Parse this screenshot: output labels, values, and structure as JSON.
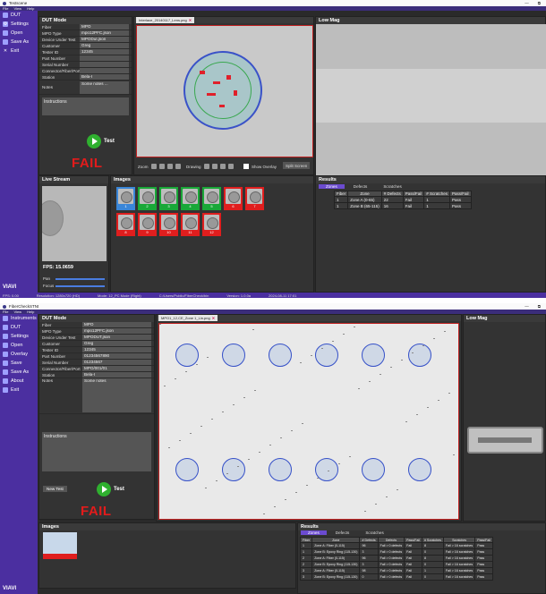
{
  "w1": {
    "title": "Testscene",
    "menu": [
      "File",
      "View",
      "Help"
    ],
    "win_controls": [
      "—",
      "⧉"
    ],
    "sidebar": [
      {
        "label": "DUT",
        "icon": "dut-icon"
      },
      {
        "label": "Settings",
        "icon": "gear-icon"
      },
      {
        "label": "Open",
        "icon": "folder-icon"
      },
      {
        "label": "Save As",
        "icon": "save-icon"
      },
      {
        "label": "Exit",
        "icon": "close-icon"
      }
    ],
    "brand": "VIAVI",
    "dut": {
      "header": "DUT Mode",
      "fields": [
        {
          "label": "Fiber",
          "value": "MPO"
        },
        {
          "label": "MPO Type",
          "value": "mpo12PFC.json"
        },
        {
          "label": "Device Under Test",
          "value": "MPODut.json"
        },
        {
          "label": "Customer",
          "value": "Greg"
        },
        {
          "label": "Tester ID",
          "value": "12345"
        },
        {
          "label": "Part Number",
          "value": ""
        },
        {
          "label": "Serial Number",
          "value": ""
        },
        {
          "label": "Connector/Fiber/Port",
          "value": ""
        },
        {
          "label": "Station",
          "value": "Bela-I"
        },
        {
          "label": "Notes",
          "value": "Some notes ..."
        }
      ],
      "instructions": "Instructions",
      "test_label": "Test",
      "result": "FAIL"
    },
    "scope_tab": "Interlace_20140117_Lens.png",
    "lowmag": "Low Mag",
    "toolbar": {
      "zoom": "Zoom",
      "drawing": "Drawing",
      "show_overlay": "Show Overlay",
      "split": "Split Screen"
    },
    "livestream": {
      "header": "Live Stream",
      "fps": "FPS: 15.0659",
      "pan": "Pan",
      "focus": "Focus"
    },
    "images": {
      "header": "Images",
      "thumbs": [
        {
          "n": "1",
          "c": "blue"
        },
        {
          "n": "2",
          "c": "green"
        },
        {
          "n": "3",
          "c": "green"
        },
        {
          "n": "4",
          "c": "green"
        },
        {
          "n": "5",
          "c": "green"
        },
        {
          "n": "6",
          "c": "red"
        },
        {
          "n": "7",
          "c": "red"
        },
        {
          "n": "8",
          "c": "red"
        },
        {
          "n": "9",
          "c": "red"
        },
        {
          "n": "10",
          "c": "red"
        },
        {
          "n": "11",
          "c": "red"
        },
        {
          "n": "12",
          "c": "red"
        }
      ]
    },
    "results": {
      "header": "Results",
      "tabs": [
        "Zones",
        "Defects",
        "Scratches"
      ],
      "cols": [
        "Fiber",
        "Zone",
        "# Defects",
        "Pass/Fail",
        "# Scratches",
        "Pass/Fail"
      ],
      "rows": [
        [
          "1",
          "Zone A (0-65)",
          "22",
          "Fail",
          "1",
          "Pass"
        ],
        [
          "1",
          "Zone B (65-115)",
          "16",
          "Fail",
          "1",
          "Pass"
        ]
      ]
    },
    "status": [
      "FPS: 0.00",
      "Resolution: 1280x720 (HD)",
      "Mode: 12_PC Mode (Right)",
      "C:/Users/Public/FiberCheck/bin",
      "Version: 1.0.0a",
      "2024-08-11 17:01"
    ]
  },
  "w2": {
    "title": "FiberCheckSTNt",
    "menu": [
      "File",
      "View",
      "Help"
    ],
    "win_controls": [
      "—",
      "⧉"
    ],
    "sidebar": [
      {
        "label": "Instruments",
        "icon": "instrument-icon"
      },
      {
        "label": "DUT",
        "icon": "dut-icon"
      },
      {
        "label": "Settings",
        "icon": "gear-icon"
      },
      {
        "label": "Open",
        "icon": "folder-icon"
      },
      {
        "label": "Overlay",
        "icon": "overlay-icon"
      },
      {
        "label": "Save",
        "icon": "save-icon"
      },
      {
        "label": "Save As",
        "icon": "save-as-icon"
      },
      {
        "label": "About",
        "icon": "info-icon"
      },
      {
        "label": "Exit",
        "icon": "close-icon"
      }
    ],
    "brand": "VIAVI",
    "dut": {
      "header": "DUT Mode",
      "fields": [
        {
          "label": "Fiber",
          "value": "MPO"
        },
        {
          "label": "MPO Type",
          "value": "mpo12PFC.json"
        },
        {
          "label": "Device Under Test",
          "value": "MPODUT.json"
        },
        {
          "label": "Customer",
          "value": "Greg"
        },
        {
          "label": "Tester ID",
          "value": "12345"
        },
        {
          "label": "Part Number",
          "value": "01234567890"
        },
        {
          "label": "Serial Number",
          "value": "01234567"
        },
        {
          "label": "Connector/Fiber/Port",
          "value": "MPO/001/01"
        },
        {
          "label": "Station",
          "value": "Bela-I"
        },
        {
          "label": "Notes",
          "value": "Some notes"
        }
      ],
      "instructions": "Instructions",
      "new_test": "New Test",
      "test_label": "Test",
      "result": "FAIL"
    },
    "scope_tab": "MPO1_12,CE_Zone 1_Lin.png",
    "lowmag": "Low Mag",
    "images": {
      "header": "Images"
    },
    "results": {
      "header": "Results",
      "tabs": [
        "Zones",
        "Defects",
        "Scratches"
      ],
      "cols": [
        "Fiber",
        "Zone",
        "# Defects",
        "Defects",
        "Pass/Fail",
        "# Scratches",
        "Scratches",
        "Pass/Fail"
      ],
      "rows": [
        [
          "1",
          "Zone A: Fiber (0-115)",
          "96",
          "Fail > 0 defects",
          "Fail",
          "8",
          "Fail > 16 scratches",
          "Pass"
        ],
        [
          "1",
          "Zone B: Epoxy Ring (115-130)",
          "3",
          "Fail > 0 defects",
          "Fail",
          "0",
          "Fail > 16 scratches",
          "Pass"
        ],
        [
          "2",
          "Zone A: Fiber (0-115)",
          "96",
          "Fail > 0 defects",
          "Fail",
          "8",
          "Fail > 16 scratches",
          "Pass"
        ],
        [
          "2",
          "Zone B: Epoxy Ring (115-130)",
          "3",
          "Fail > 0 defects",
          "Fail",
          "0",
          "Fail > 16 scratches",
          "Pass"
        ],
        [
          "3",
          "Zone A: Fiber (0-115)",
          "98",
          "Fail > 0 defects",
          "Fail",
          "1",
          "Fail > 16 scratches",
          "Pass"
        ],
        [
          "3",
          "Zone B: Epoxy Ring (115-130)",
          "0",
          "Fail > 0 defects",
          "Fail",
          "0",
          "Fail > 16 scratches",
          "Pass"
        ]
      ]
    }
  }
}
